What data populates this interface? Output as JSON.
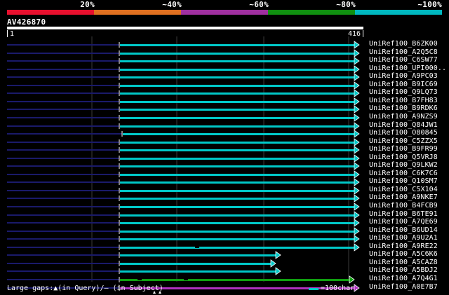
{
  "legend": {
    "segments": [
      {
        "color": "#e8102e",
        "label": "20%"
      },
      {
        "color": "#e07020",
        "label": "~40%"
      },
      {
        "color": "#a030a0",
        "label": "~60%"
      },
      {
        "color": "#109010",
        "label": "~80%"
      },
      {
        "color": "#00b8c0",
        "label": "~100%"
      }
    ]
  },
  "query": {
    "id": "AV426870",
    "start": "1",
    "end": "416"
  },
  "hits": [
    {
      "label": "UniRef100_B6ZK00",
      "start": 170,
      "end": 512,
      "color": "#00c8c8"
    },
    {
      "label": "UniRef100_A2Q5C8",
      "start": 170,
      "end": 512,
      "color": "#00c8c8"
    },
    {
      "label": "UniRef100_C6SW77",
      "start": 170,
      "end": 512,
      "color": "#00c8c8"
    },
    {
      "label": "UniRef100_UPI000..",
      "start": 170,
      "end": 512,
      "color": "#00c8c8"
    },
    {
      "label": "UniRef100_A9PC03",
      "start": 170,
      "end": 512,
      "color": "#00c8c8"
    },
    {
      "label": "UniRef100_B9IC69",
      "start": 170,
      "end": 512,
      "color": "#00c8c8"
    },
    {
      "label": "UniRef100_Q9LQ73",
      "start": 170,
      "end": 512,
      "color": "#00c8c8"
    },
    {
      "label": "UniRef100_B7FH83",
      "start": 170,
      "end": 512,
      "color": "#00c8c8"
    },
    {
      "label": "UniRef100_B9RDK6",
      "start": 170,
      "end": 512,
      "color": "#00c8c8"
    },
    {
      "label": "UniRef100_A9NZS9",
      "start": 170,
      "end": 512,
      "color": "#00c8c8"
    },
    {
      "label": "UniRef100_Q84JW1",
      "start": 170,
      "end": 512,
      "color": "#00c8c8"
    },
    {
      "label": "UniRef100_O80845",
      "start": 174,
      "end": 512,
      "color": "#00c8c8"
    },
    {
      "label": "UniRef100_C5ZZX5",
      "start": 170,
      "end": 512,
      "color": "#00c8c8"
    },
    {
      "label": "UniRef100_B9FR99",
      "start": 170,
      "end": 512,
      "color": "#00c8c8"
    },
    {
      "label": "UniRef100_Q5VRJ8",
      "start": 170,
      "end": 512,
      "color": "#00c8c8"
    },
    {
      "label": "UniRef100_Q9LKW2",
      "start": 170,
      "end": 512,
      "color": "#00c8c8"
    },
    {
      "label": "UniRef100_C6K7C6",
      "start": 170,
      "end": 512,
      "color": "#00c8c8"
    },
    {
      "label": "UniRef100_Q10SM7",
      "start": 170,
      "end": 512,
      "color": "#00c8c8"
    },
    {
      "label": "UniRef100_C5X104",
      "start": 170,
      "end": 512,
      "color": "#00c8c8"
    },
    {
      "label": "UniRef100_A9NKE7",
      "start": 170,
      "end": 512,
      "color": "#00c8c8"
    },
    {
      "label": "UniRef100_B4FCB9",
      "start": 170,
      "end": 512,
      "color": "#00c8c8"
    },
    {
      "label": "UniRef100_B6TE91",
      "start": 170,
      "end": 512,
      "color": "#00c8c8"
    },
    {
      "label": "UniRef100_A7QE69",
      "start": 170,
      "end": 512,
      "color": "#00c8c8"
    },
    {
      "label": "UniRef100_B6UD14",
      "start": 170,
      "end": 512,
      "color": "#00c8c8"
    },
    {
      "label": "UniRef100_A9U2A1",
      "start": 170,
      "end": 512,
      "color": "#00c8c8"
    },
    {
      "label": "UniRef100_A9RE22",
      "start": 170,
      "end": 512,
      "color": "#00c8c8"
    },
    {
      "label": "UniRef100_A5C6K6",
      "start": 170,
      "end": 400,
      "color": "#00c8c8"
    },
    {
      "label": "UniRef100_A5CAZ8",
      "start": 170,
      "end": 393,
      "color": "#00c8c8"
    },
    {
      "label": "UniRef100_A5BDJ2",
      "start": 170,
      "end": 400,
      "color": "#00c8c8"
    },
    {
      "label": "UniRef100_A7Q4G1",
      "start": 170,
      "end": 505,
      "color": "#10a010"
    },
    {
      "label": "UniRef100_A0E7B7",
      "start": 170,
      "end": 512,
      "color": "#b030c0"
    }
  ],
  "footer": {
    "gaps_text": "Large gaps:▲(in Query)/– (in Subject)",
    "scale_text": "=100char."
  }
}
